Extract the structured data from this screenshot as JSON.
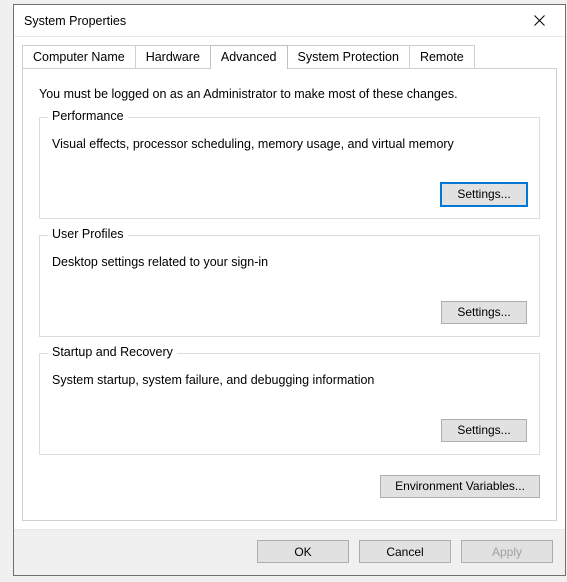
{
  "titlebar": {
    "title": "System Properties"
  },
  "tabs": {
    "computer_name": "Computer Name",
    "hardware": "Hardware",
    "advanced": "Advanced",
    "system_protection": "System Protection",
    "remote": "Remote"
  },
  "intro": "You must be logged on as an Administrator to make most of these changes.",
  "groups": {
    "performance": {
      "title": "Performance",
      "desc": "Visual effects, processor scheduling, memory usage, and virtual memory",
      "settings_label": "Settings..."
    },
    "user_profiles": {
      "title": "User Profiles",
      "desc": "Desktop settings related to your sign-in",
      "settings_label": "Settings..."
    },
    "startup": {
      "title": "Startup and Recovery",
      "desc": "System startup, system failure, and debugging information",
      "settings_label": "Settings..."
    }
  },
  "env_button": "Environment Variables...",
  "bottom": {
    "ok": "OK",
    "cancel": "Cancel",
    "apply": "Apply"
  }
}
